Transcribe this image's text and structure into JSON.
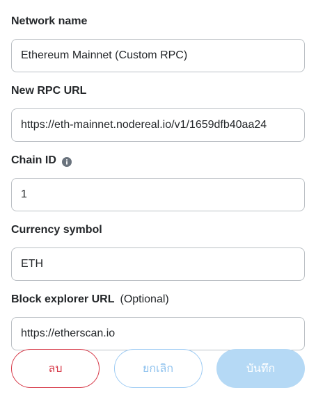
{
  "form": {
    "network_name": {
      "label": "Network name",
      "value": "Ethereum Mainnet (Custom RPC)"
    },
    "rpc_url": {
      "label": "New RPC URL",
      "value": "https://eth-mainnet.nodereal.io/v1/1659dfb40aa24"
    },
    "chain_id": {
      "label": "Chain ID",
      "value": "1",
      "icon": "info-icon"
    },
    "currency_symbol": {
      "label": "Currency symbol",
      "value": "ETH"
    },
    "block_explorer": {
      "label": "Block explorer URL",
      "optional": "(Optional)",
      "value": "https://etherscan.io"
    }
  },
  "buttons": {
    "delete_label": "ลบ",
    "cancel_label": "ยกเลิก",
    "save_label": "บันทึก"
  },
  "colors": {
    "delete": "#d73a49",
    "cancel": "#8fc2ee",
    "save_bg": "#b5d9f5",
    "border": "#bbc0c5"
  }
}
